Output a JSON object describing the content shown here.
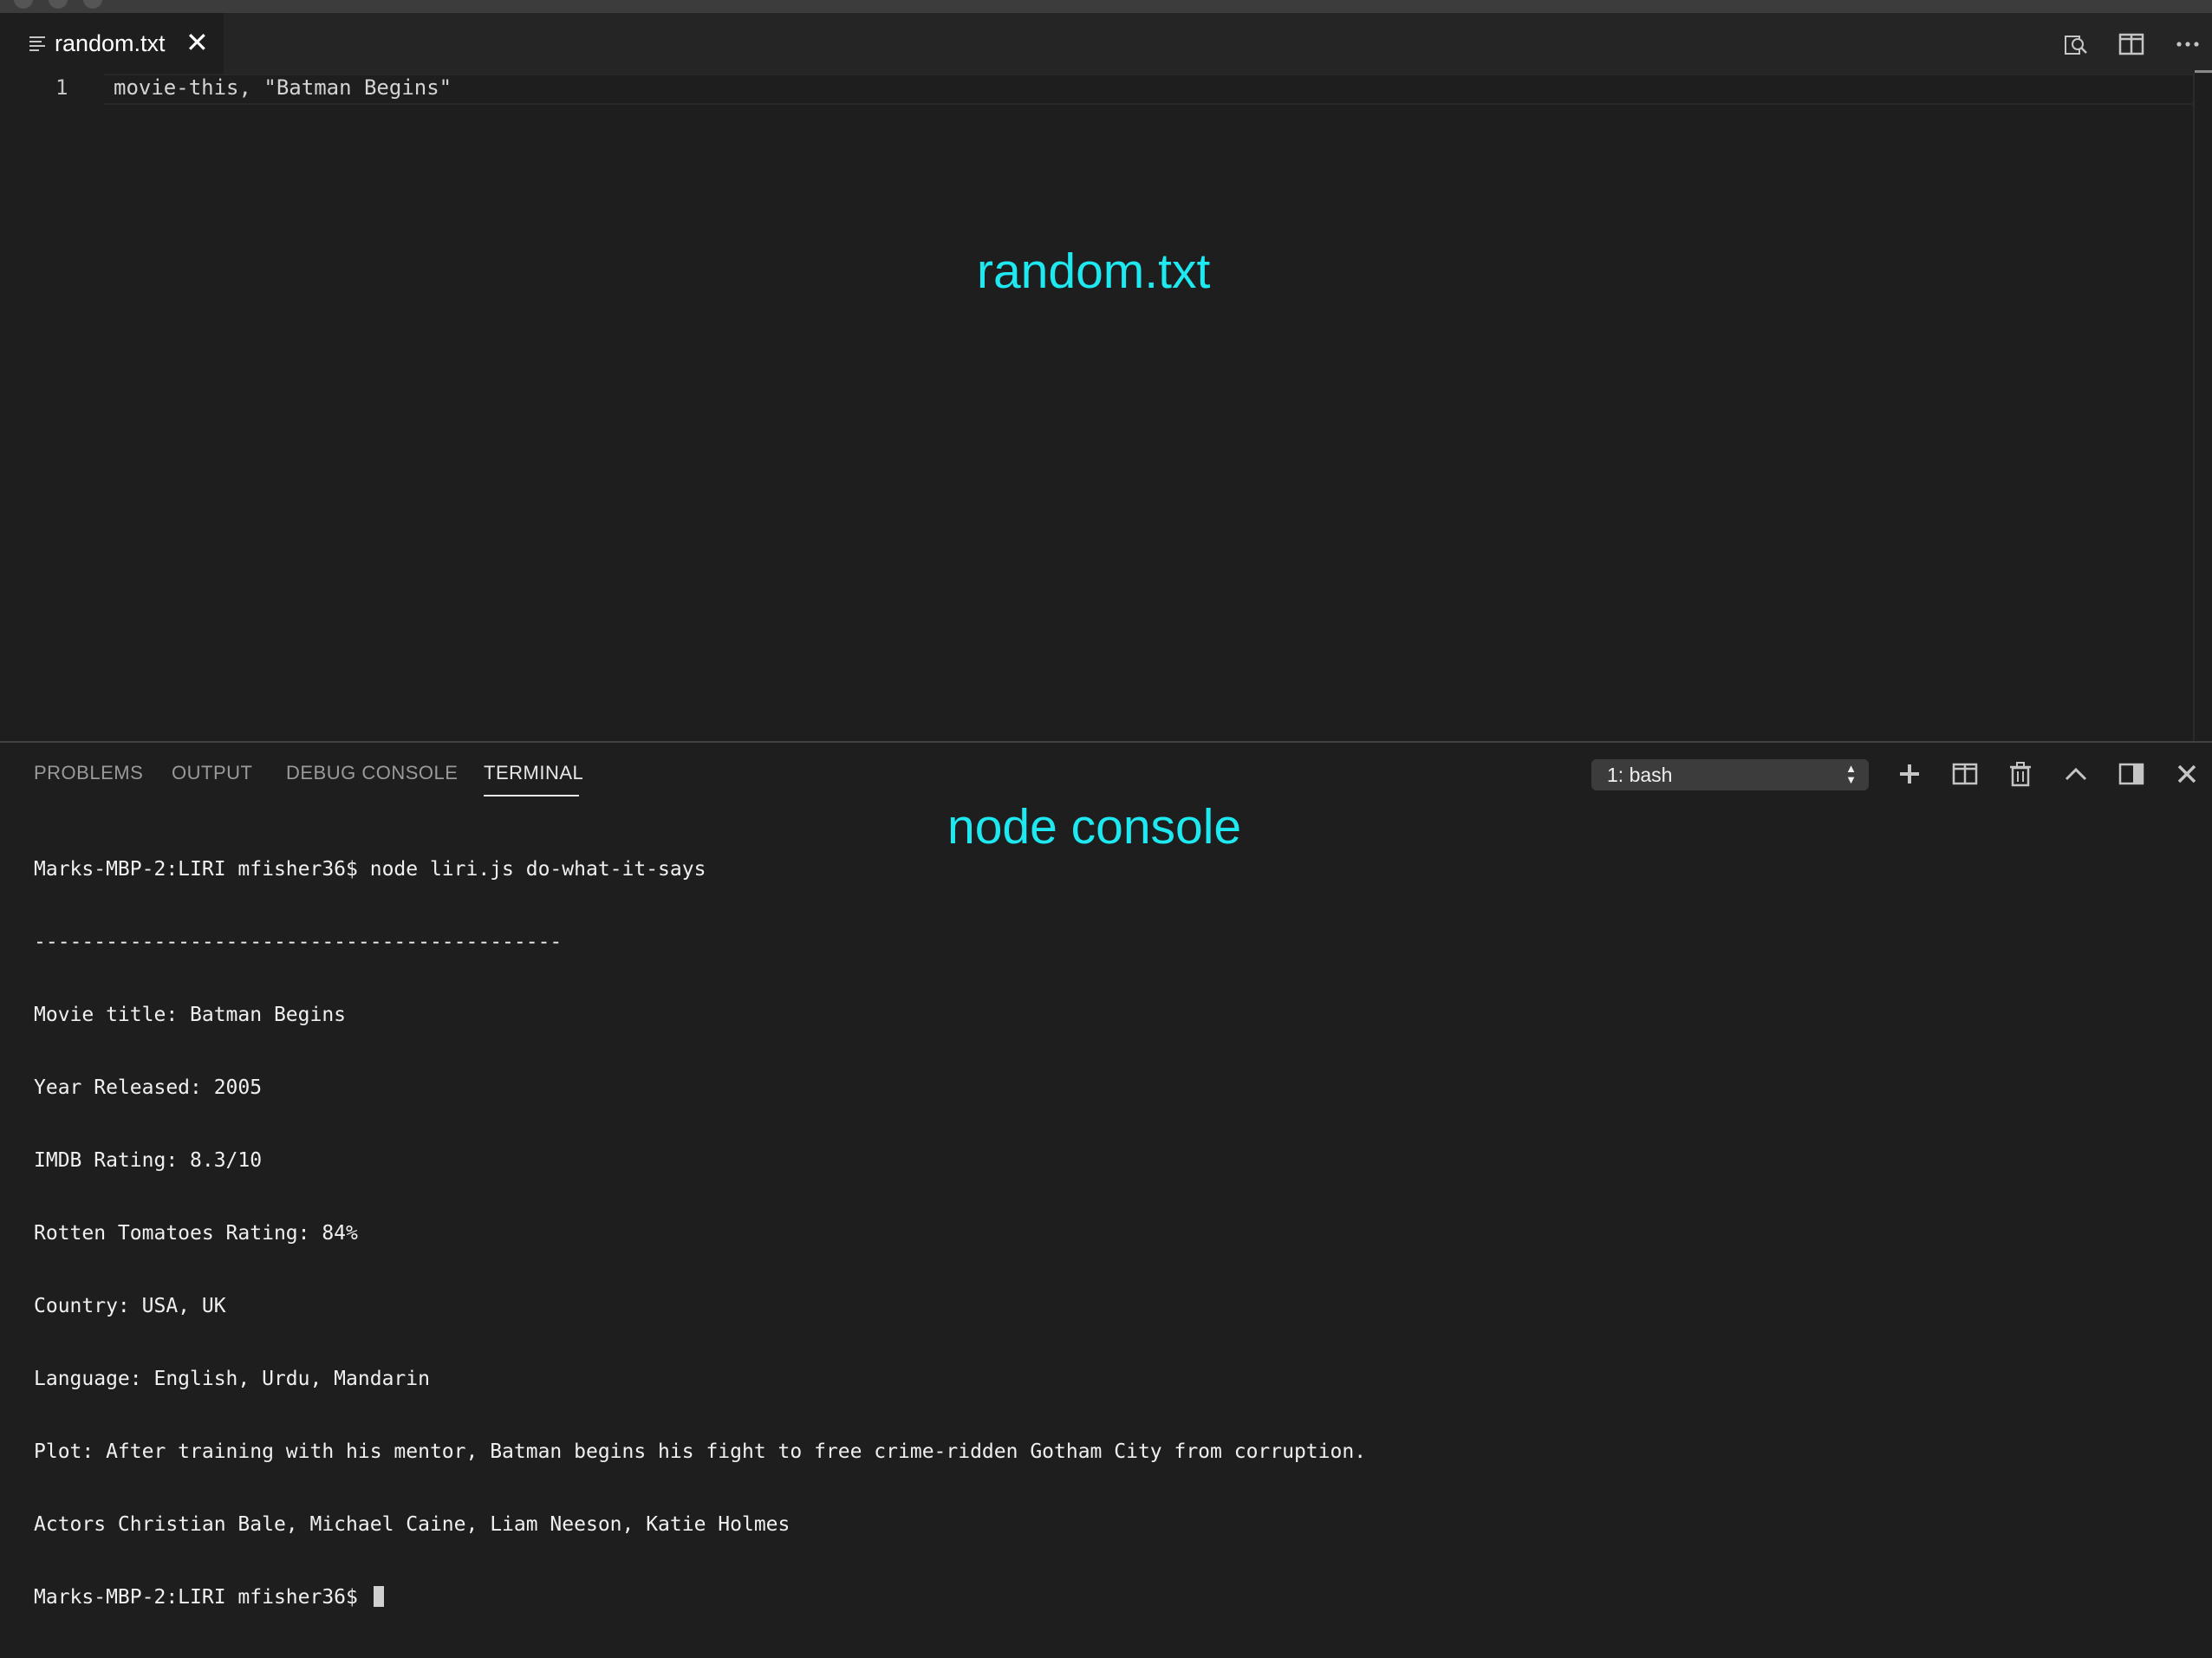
{
  "editor": {
    "tab_label": "random.txt",
    "tab_close": "✕",
    "lines": [
      {
        "number": "1",
        "text": "movie-this, \"Batman Begins\""
      }
    ]
  },
  "annotations": {
    "editor_label": "random.txt",
    "console_label": "node console",
    "color": "#1ee8f0"
  },
  "panel": {
    "tabs": [
      "PROBLEMS",
      "OUTPUT",
      "DEBUG CONSOLE",
      "TERMINAL"
    ],
    "active_tab": "TERMINAL",
    "terminal_select": "1: bash",
    "terminal_lines": [
      "Marks-MBP-2:LIRI mfisher36$ node liri.js do-what-it-says",
      "--------------------------------------------",
      "Movie title: Batman Begins",
      "Year Released: 2005",
      "IMDB Rating: 8.3/10",
      "Rotten Tomatoes Rating: 84%",
      "Country: USA, UK",
      "Language: English, Urdu, Mandarin",
      "Plot: After training with his mentor, Batman begins his fight to free crime-ridden Gotham City from corruption.",
      "Actors Christian Bale, Michael Caine, Liam Neeson, Katie Holmes"
    ],
    "prompt": "Marks-MBP-2:LIRI mfisher36$ "
  },
  "icons": {
    "editor_actions": [
      "open-changes-icon",
      "split-editor-icon",
      "more-actions-icon"
    ],
    "panel_actions": [
      "new-terminal-icon",
      "split-terminal-icon",
      "kill-terminal-icon",
      "maximize-panel-icon",
      "toggle-panel-position-icon",
      "close-panel-icon"
    ]
  }
}
